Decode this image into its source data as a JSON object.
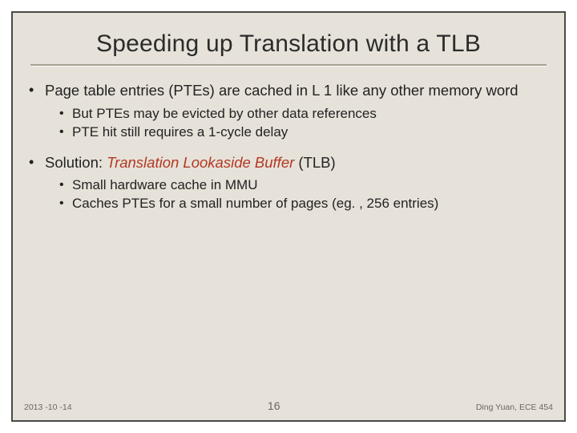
{
  "title": "Speeding up Translation with a TLB",
  "bullets": {
    "b1": "Page table entries (PTEs) are cached in L 1 like any other memory word",
    "b1_sub1": "But PTEs may be evicted by other data references",
    "b1_sub2": "PTE hit still requires a 1-cycle delay",
    "b2_prefix": "Solution: ",
    "b2_em": "Translation Lookaside Buffer",
    "b2_suffix": " (TLB)",
    "b2_sub1": "Small hardware cache in MMU",
    "b2_sub2": "Caches PTEs for a small number of pages (eg. , 256 entries)"
  },
  "footer": {
    "date": "2013 -10 -14",
    "page": "16",
    "author": "Ding Yuan, ECE 454"
  }
}
